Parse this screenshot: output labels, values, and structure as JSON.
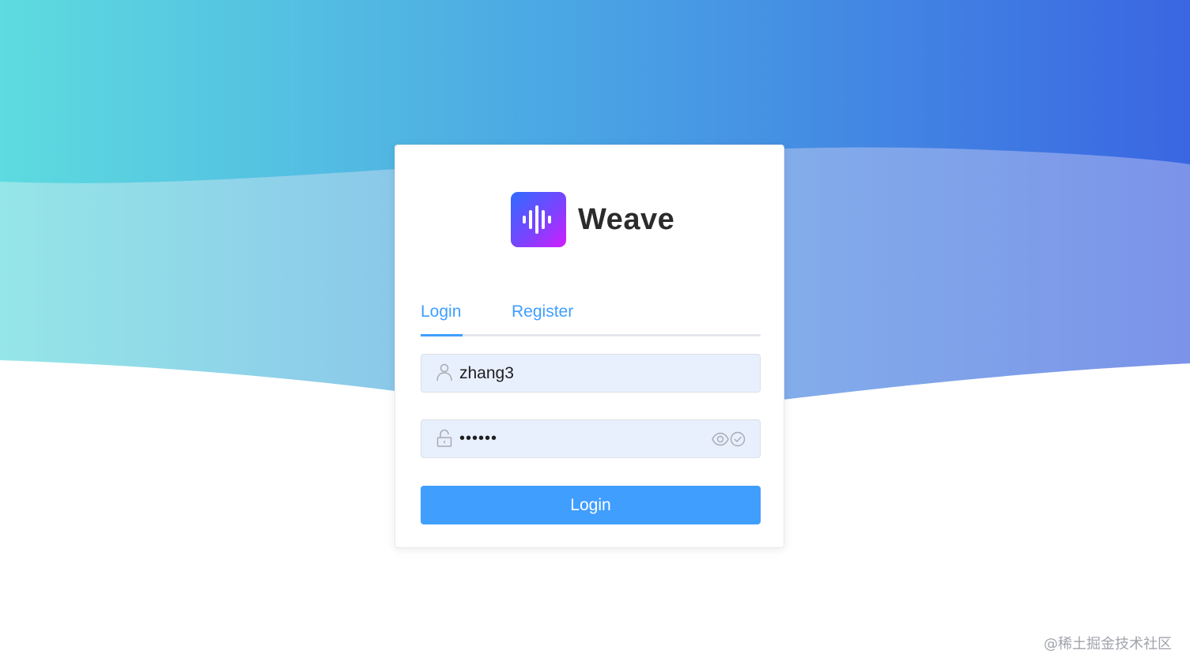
{
  "app": {
    "name": "Weave",
    "logo_icon": "sound-wave-icon"
  },
  "tabs": [
    {
      "label": "Login",
      "active": true
    },
    {
      "label": "Register",
      "active": false
    }
  ],
  "form": {
    "username": {
      "value": "zhang3",
      "icon": "user-icon"
    },
    "password": {
      "value": "••••••",
      "icon": "lock-icon",
      "suffix_icons": [
        "eye-icon",
        "check-circle-icon"
      ]
    },
    "submit_label": "Login"
  },
  "watermark": "@稀土掘金技术社区",
  "colors": {
    "accent": "#409eff",
    "input_bg": "#e8f0fe",
    "bg_gradient_start": "#5ddbdf",
    "bg_gradient_end": "#3a66e2"
  }
}
